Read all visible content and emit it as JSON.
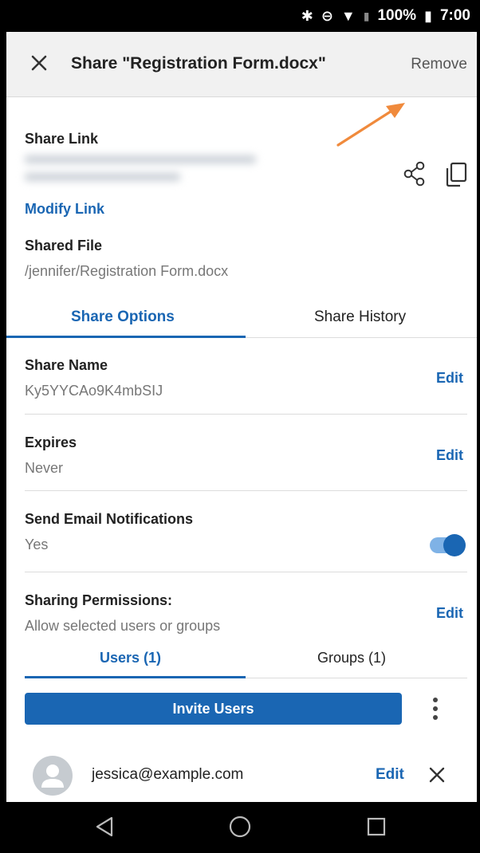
{
  "status_bar": {
    "battery": "100%",
    "time": "7:00",
    "icons": [
      "bluetooth-icon",
      "do-not-disturb-icon",
      "wifi-icon",
      "signal-icon",
      "battery-icon"
    ]
  },
  "header": {
    "title": "Share \"Registration Form.docx\"",
    "remove_label": "Remove",
    "close_icon": "close-icon"
  },
  "share_link": {
    "label": "Share Link",
    "modify_label": "Modify Link",
    "share_icon": "share-icon",
    "copy_icon": "copy-icon"
  },
  "shared_file": {
    "label": "Shared File",
    "path": "/jennifer/Registration Form.docx"
  },
  "tabs": [
    {
      "label": "Share Options",
      "active": true
    },
    {
      "label": "Share History",
      "active": false
    }
  ],
  "options": {
    "share_name": {
      "title": "Share Name",
      "value": "Ky5YYCAo9K4mbSIJ",
      "edit_label": "Edit"
    },
    "expires": {
      "title": "Expires",
      "value": "Never",
      "edit_label": "Edit"
    },
    "email_notifications": {
      "title": "Send Email Notifications",
      "value": "Yes",
      "enabled": true
    },
    "permissions": {
      "title": "Sharing Permissions:",
      "value": "Allow selected users or groups",
      "edit_label": "Edit"
    }
  },
  "sub_tabs": [
    {
      "label": "Users (1)",
      "active": true
    },
    {
      "label": "Groups (1)",
      "active": false
    }
  ],
  "invite_label": "Invite Users",
  "users": [
    {
      "email": "jessica@example.com",
      "edit_label": "Edit"
    }
  ],
  "colors": {
    "accent": "#1a66b3",
    "annotation_arrow": "#f08a3c"
  }
}
